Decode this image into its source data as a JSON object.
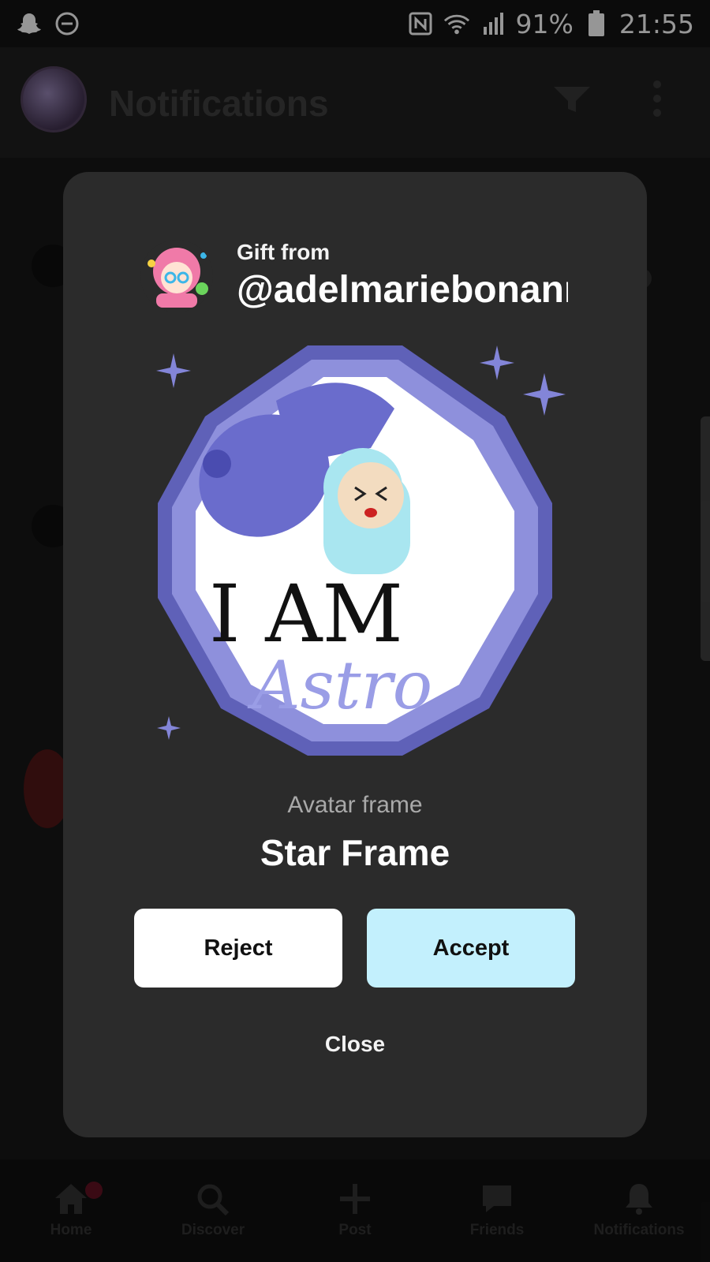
{
  "status_bar": {
    "battery": "91%",
    "time": "21:55",
    "icons": [
      "snapchat-icon",
      "do-not-disturb-icon",
      "nfc-icon",
      "wifi-icon",
      "signal-icon",
      "battery-icon"
    ]
  },
  "header": {
    "title": "Notifications",
    "icons": [
      "filter-icon",
      "more-vertical-icon"
    ]
  },
  "bottom_nav": {
    "items": [
      {
        "label": "Home",
        "icon": "home-icon"
      },
      {
        "label": "Discover",
        "icon": "search-icon"
      },
      {
        "label": "Post",
        "icon": "plus-icon"
      },
      {
        "label": "Friends",
        "icon": "chat-icon"
      },
      {
        "label": "Notifications",
        "icon": "bell-icon"
      }
    ]
  },
  "gift_modal": {
    "gift_from_label": "Gift from",
    "username": "@adelmariebonanno",
    "item_type": "Avatar frame",
    "item_name": "Star Frame",
    "frame_text": "I AM",
    "frame_subtext": "Astro",
    "reject_label": "Reject",
    "accept_label": "Accept",
    "close_label": "Close",
    "colors": {
      "accept_bg": "#c3f0fd",
      "reject_bg": "#ffffff",
      "modal_bg": "#2b2b2b",
      "frame_purple": "#6e70c8"
    }
  }
}
